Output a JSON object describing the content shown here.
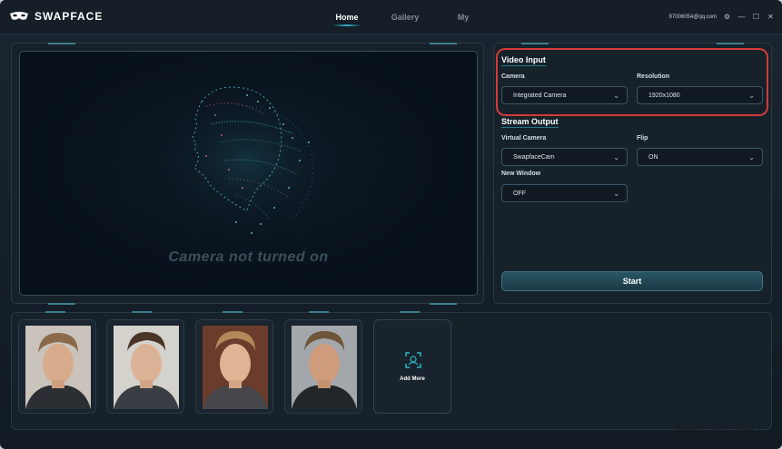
{
  "app": {
    "name": "SWAPFACE",
    "accent": "#2fb6c8",
    "highlight": "#d33a3a"
  },
  "nav": [
    {
      "label": "Home",
      "active": true
    },
    {
      "label": "Gallery",
      "active": false
    },
    {
      "label": "My",
      "active": false
    }
  ],
  "account": {
    "email": "97006054@qq.com"
  },
  "video": {
    "status": "Camera not turned on"
  },
  "video_input": {
    "title": "Video Input",
    "camera": {
      "label": "Camera",
      "value": "Integrated Camera"
    },
    "resolution": {
      "label": "Resolution",
      "value": "1920x1080"
    }
  },
  "stream_output": {
    "title": "Stream Output",
    "virtual_camera": {
      "label": "Virtual Camera",
      "value": "SwapfaceCam"
    },
    "flip": {
      "label": "Flip",
      "value": "ON"
    },
    "new_window": {
      "label": "New Window",
      "value": "OFF"
    }
  },
  "start_label": "Start",
  "add_more_label": "Add More",
  "watermark": "CSDN @A. 張さん",
  "icons": [
    "mask-logo-icon",
    "gear-icon",
    "minimize-icon",
    "maximize-icon",
    "close-icon",
    "chevron-down-icon",
    "face-scan-icon"
  ]
}
